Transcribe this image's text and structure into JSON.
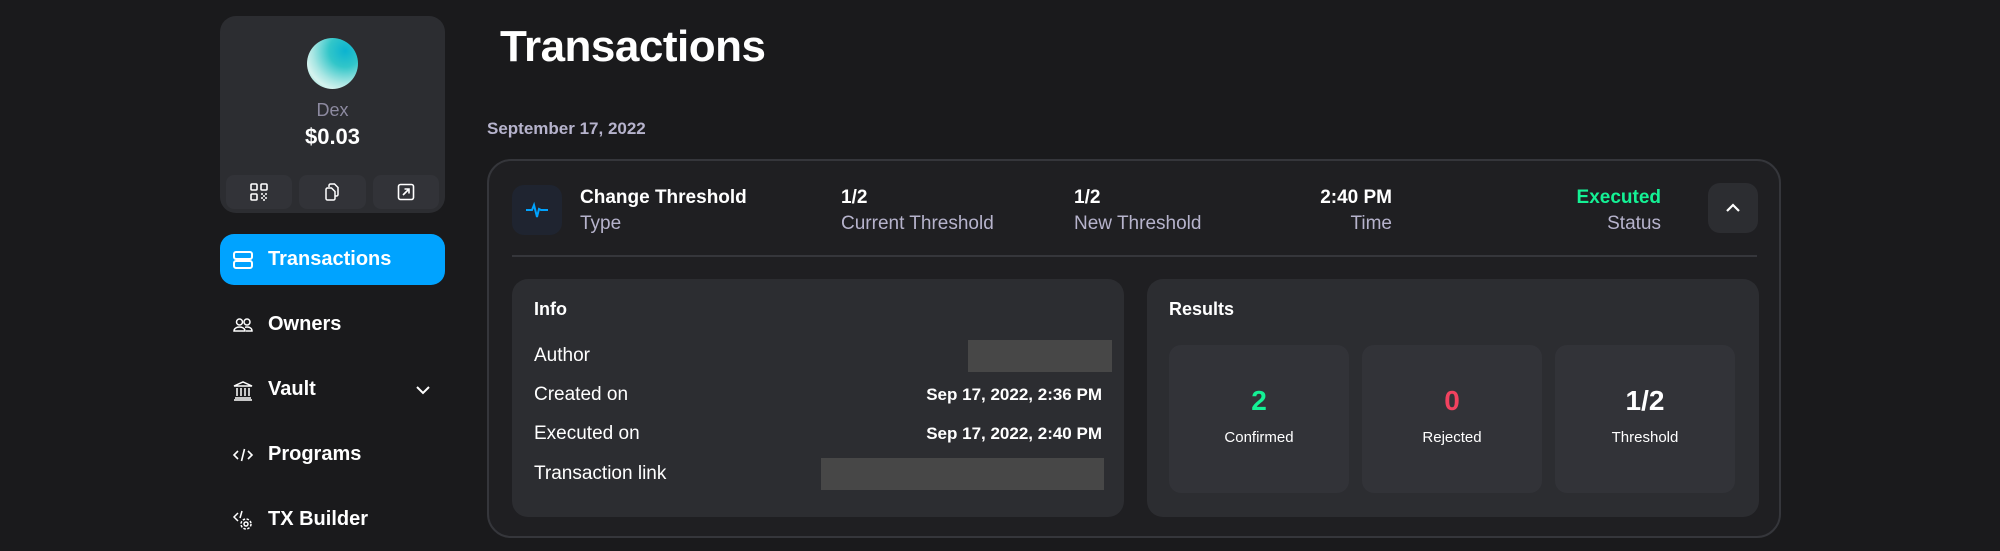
{
  "wallet": {
    "name": "Dex",
    "balance": "$0.03",
    "actions": [
      {
        "icon": "qr-code-icon",
        "label": "QR code"
      },
      {
        "icon": "copy-icon",
        "label": "Copy address"
      },
      {
        "icon": "external-link-icon",
        "label": "Open in explorer"
      }
    ]
  },
  "sidebar": {
    "items": [
      {
        "label": "Transactions",
        "icon": "transactions-icon",
        "active": true
      },
      {
        "label": "Owners",
        "icon": "owners-icon",
        "active": false
      },
      {
        "label": "Vault",
        "icon": "bank-icon",
        "active": false,
        "expandable": true
      },
      {
        "label": "Programs",
        "icon": "code-icon",
        "active": false
      },
      {
        "label": "TX Builder",
        "icon": "code-gear-icon",
        "active": false
      }
    ]
  },
  "page": {
    "title": "Transactions",
    "date_group": "September 17, 2022"
  },
  "transaction": {
    "type_value": "Change Threshold",
    "type_label": "Type",
    "current_threshold_value": "1/2",
    "current_threshold_label": "Current Threshold",
    "new_threshold_value": "1/2",
    "new_threshold_label": "New Threshold",
    "time_value": "2:40 PM",
    "time_label": "Time",
    "status_value": "Executed",
    "status_label": "Status",
    "status_color": "#14f195",
    "info": {
      "title": "Info",
      "rows": [
        {
          "key": "Author",
          "value": ""
        },
        {
          "key": "Created on",
          "value": "Sep 17, 2022, 2:36 PM"
        },
        {
          "key": "Executed on",
          "value": "Sep 17, 2022, 2:40 PM"
        },
        {
          "key": "Transaction link",
          "value": ""
        }
      ]
    },
    "results": {
      "title": "Results",
      "items": [
        {
          "value": "2",
          "label": "Confirmed",
          "color": "#14f195"
        },
        {
          "value": "0",
          "label": "Rejected",
          "color": "#f2425f"
        },
        {
          "value": "1/2",
          "label": "Threshold",
          "color": "#ffffff"
        }
      ]
    }
  },
  "colors": {
    "accent": "#00a3ff",
    "background": "#1a1a1c",
    "card": "#2c2d31"
  }
}
